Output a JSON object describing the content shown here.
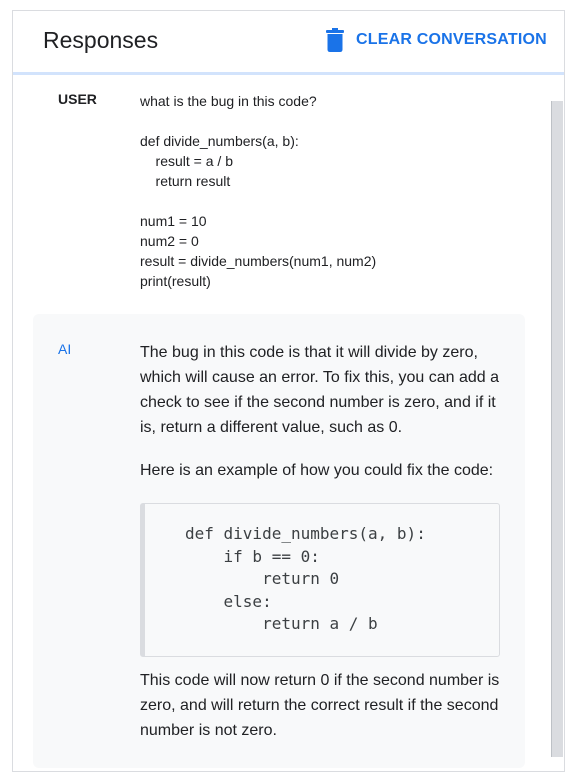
{
  "header": {
    "title": "Responses",
    "clear_label": "CLEAR CONVERSATION",
    "clear_icon": "trash-icon",
    "accent_color": "#1a73e8"
  },
  "conversation": {
    "user": {
      "role": "USER",
      "message": "what is the bug in this code?\n\ndef divide_numbers(a, b):\n    result = a / b\n    return result\n\nnum1 = 10\nnum2 = 0\nresult = divide_numbers(num1, num2)\nprint(result)"
    },
    "ai": {
      "role": "AI",
      "paragraph_1": "The bug in this code is that it will divide by zero, which will cause an error. To fix this, you can add a check to see if the second number is zero, and if it is, return a different value, such as 0.",
      "paragraph_2": "Here is an example of how you could fix the code:",
      "code": "def divide_numbers(a, b):\n    if b == 0:\n        return 0\n    else:\n        return a / b",
      "paragraph_3": "This code will now return 0 if the second number is zero, and will return the correct result if the second number is not zero."
    }
  }
}
